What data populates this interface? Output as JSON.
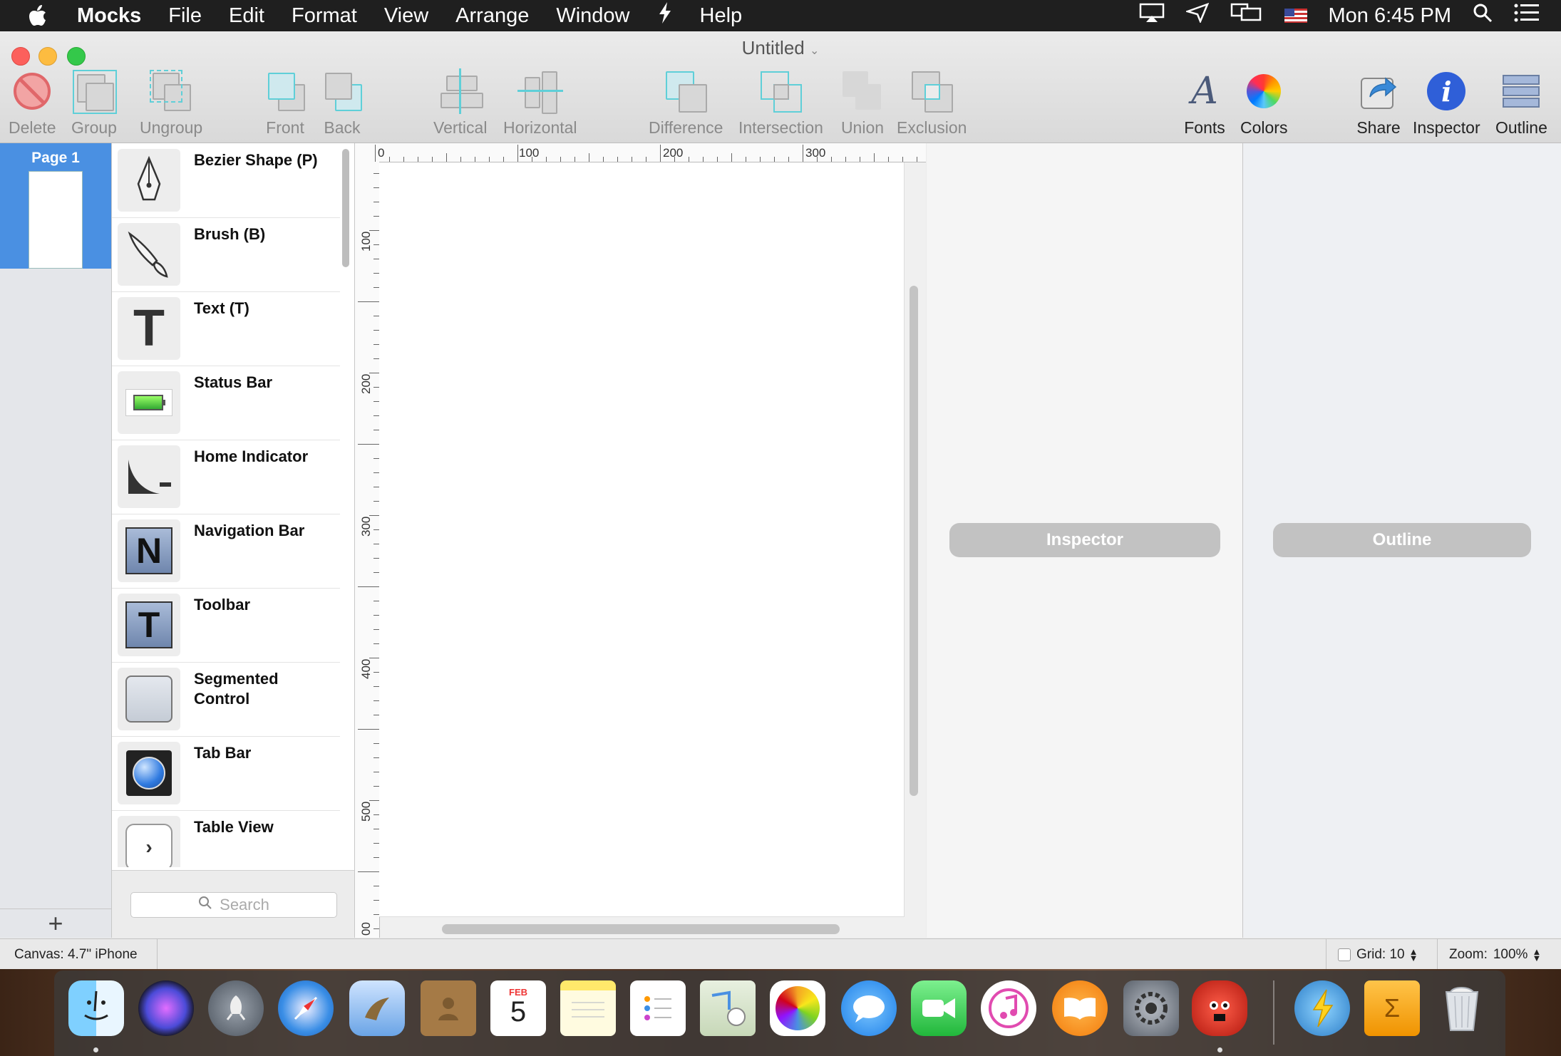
{
  "menubar": {
    "app_name": "Mocks",
    "items": [
      "File",
      "Edit",
      "Format",
      "View",
      "Arrange",
      "Window",
      "Help"
    ],
    "clock": "Mon 6:45 PM"
  },
  "window": {
    "title": "Untitled"
  },
  "toolbar": {
    "delete": "Delete",
    "group": "Group",
    "ungroup": "Ungroup",
    "front": "Front",
    "back": "Back",
    "vertical": "Vertical",
    "horizontal": "Horizontal",
    "difference": "Difference",
    "intersection": "Intersection",
    "union": "Union",
    "exclusion": "Exclusion",
    "fonts": "Fonts",
    "colors": "Colors",
    "share": "Share",
    "inspector": "Inspector",
    "outline": "Outline"
  },
  "pages": {
    "items": [
      {
        "label": "Page 1"
      }
    ],
    "add_label": "+"
  },
  "library": {
    "items": [
      {
        "label": "Bezier Shape (P)",
        "icon": "pen-icon"
      },
      {
        "label": "Brush (B)",
        "icon": "brush-icon"
      },
      {
        "label": "Text (T)",
        "icon": "text-icon"
      },
      {
        "label": "Status Bar",
        "icon": "battery-icon"
      },
      {
        "label": "Home Indicator",
        "icon": "home-indicator-icon"
      },
      {
        "label": "Navigation Bar",
        "icon": "navigation-bar-icon"
      },
      {
        "label": "Toolbar",
        "icon": "toolbar-icon"
      },
      {
        "label": "Segmented Control",
        "icon": "segmented-control-icon"
      },
      {
        "label": "Tab Bar",
        "icon": "tab-bar-icon"
      },
      {
        "label": "Table View",
        "icon": "table-view-icon"
      }
    ],
    "search_placeholder": "Search"
  },
  "rulers": {
    "top_labels": [
      "0",
      "100",
      "200",
      "300"
    ],
    "left_labels": [
      "100",
      "200",
      "300",
      "400",
      "500",
      "00"
    ]
  },
  "inspector": {
    "label": "Inspector"
  },
  "outline": {
    "label": "Outline"
  },
  "statusbar": {
    "canvas": "Canvas: 4.7\" iPhone",
    "grid": "Grid: 10",
    "zoom": "Zoom:",
    "zoom_value": "100%"
  },
  "calendar": {
    "month": "FEB",
    "day": "5"
  },
  "colors": {
    "accent": "#4a90e2",
    "delete_red": "#e0676a",
    "selection_cyan": "#5fcfd8",
    "inspector_blue": "#2f5fd8"
  }
}
